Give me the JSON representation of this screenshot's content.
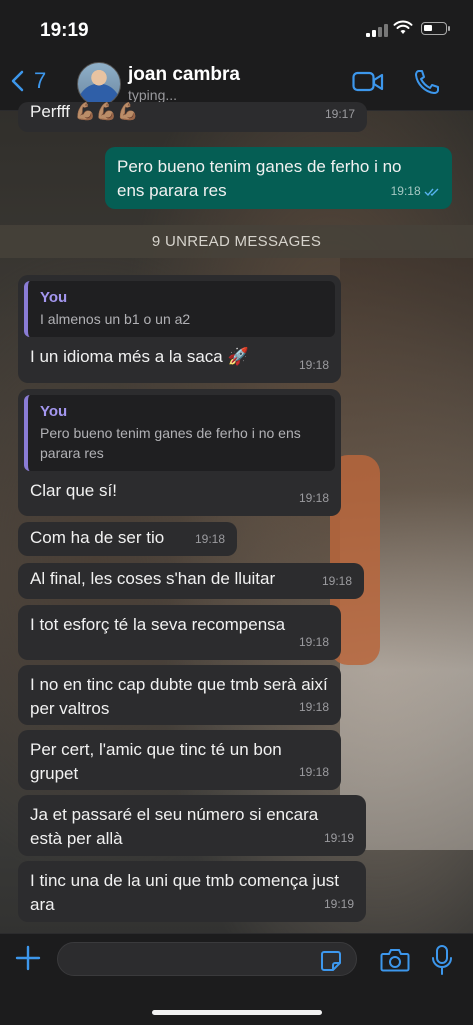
{
  "status_bar": {
    "time": "19:19"
  },
  "header": {
    "back_count": "7",
    "contact_name": "joan cambra",
    "contact_status": "typing..."
  },
  "messages": [
    {
      "text": "Perfff 💪🏽💪🏽💪🏽",
      "time": "19:17",
      "direction": "in"
    },
    {
      "text": "Pero bueno tenim ganes de ferho i no ens parara res",
      "time": "19:18",
      "direction": "out",
      "read": true
    },
    {
      "quote_author": "You",
      "quote_text": "I almenos un b1 o un a2",
      "text": "I un idioma més a la saca 🚀",
      "time": "19:18",
      "direction": "in"
    },
    {
      "quote_author": "You",
      "quote_text": "Pero bueno tenim ganes de ferho i no ens parara res",
      "text": "Clar que sí!",
      "time": "19:18",
      "direction": "in"
    },
    {
      "text": "Com ha de ser tio",
      "time": "19:18",
      "direction": "in"
    },
    {
      "text": "Al final, les coses s'han de lluitar",
      "time": "19:18",
      "direction": "in"
    },
    {
      "text": "I tot esforç té la seva recompensa",
      "time": "19:18",
      "direction": "in"
    },
    {
      "text": "I no en tinc cap dubte que tmb serà així per valtros",
      "time": "19:18",
      "direction": "in"
    },
    {
      "text": "Per cert, l'amic que tinc té un bon grupet",
      "time": "19:18",
      "direction": "in"
    },
    {
      "text": "Ja et passaré el seu número si encara està per allà",
      "time": "19:19",
      "direction": "in"
    },
    {
      "text": "I tinc una de la uni que tmb comença just ara",
      "time": "19:19",
      "direction": "in"
    }
  ],
  "unread_banner": "9 UNREAD MESSAGES",
  "icons": {
    "back": "chevron-left-icon",
    "video": "video-camera-icon",
    "call": "phone-icon",
    "plus": "plus-icon",
    "sticker": "sticker-icon",
    "camera": "camera-icon",
    "mic": "microphone-icon"
  },
  "colors": {
    "accent": "#3d97ec",
    "outgoing_bubble": "#055e54",
    "incoming_bubble": "#2c2c2e",
    "quote_bar": "#8a7cd6"
  }
}
